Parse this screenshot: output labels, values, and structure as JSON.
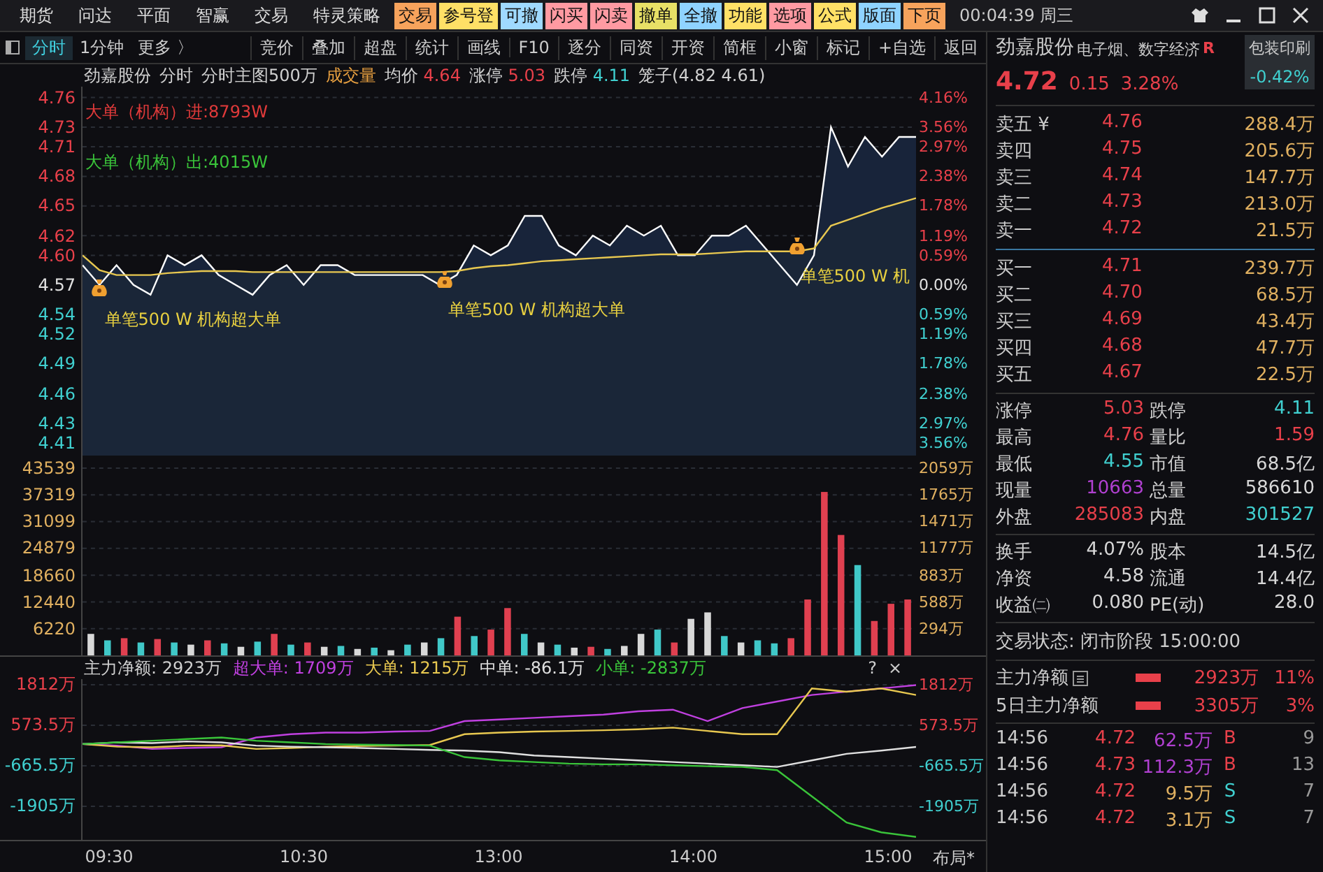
{
  "top_menu": {
    "items": [
      {
        "label": "期货"
      },
      {
        "label": "问达"
      },
      {
        "label": "平面"
      },
      {
        "label": "智赢"
      },
      {
        "label": "交易"
      },
      {
        "label": "特灵策略"
      }
    ],
    "buttons": [
      {
        "label": "交易",
        "color": "#f7a35c"
      },
      {
        "label": "参号登",
        "color": "#ffe066"
      },
      {
        "label": "可撤",
        "color": "#9fd9ff"
      },
      {
        "label": "闪买",
        "color": "#ff9aa2"
      },
      {
        "label": "闪卖",
        "color": "#ff9aa2"
      },
      {
        "label": "撤单",
        "color": "#e8e066"
      },
      {
        "label": "全撤",
        "color": "#8fd3ff"
      },
      {
        "label": "功能",
        "color": "#ffe066"
      },
      {
        "label": "选项",
        "color": "#ff9aa2"
      },
      {
        "label": "公式",
        "color": "#ffe066"
      },
      {
        "label": "版面",
        "color": "#8fd3ff"
      },
      {
        "label": "下页",
        "color": "#f7a35c"
      }
    ],
    "clock": "00:04:39",
    "weekday": "周三"
  },
  "toolbar": {
    "tabs": [
      {
        "label": "分时",
        "selected": true
      },
      {
        "label": "1分钟",
        "selected": false
      },
      {
        "label": "更多 〉",
        "selected": false
      }
    ],
    "items": [
      "竞价",
      "叠加",
      "超盘",
      "统计",
      "画线",
      "F10",
      "逐分",
      "同资",
      "开资",
      "简框",
      "小窗",
      "标记",
      "+自选",
      "返回"
    ]
  },
  "chart_header": {
    "name": "劲嘉股份",
    "mode": "分时",
    "main": "分时主图500万",
    "volume": "成交量",
    "avg": "4.64",
    "limit_up_label": "涨停",
    "limit_up": "5.03",
    "limit_down_label": "跌停",
    "limit_down": "4.11",
    "cage": "笼子(4.82 4.61)"
  },
  "price_chart": {
    "legend": [
      {
        "text": "大单（机构）进:8793W",
        "color": "#e03a3a"
      },
      {
        "text": "大单（机构）出:4015W",
        "color": "#3ac43a"
      }
    ],
    "right_labels": [
      {
        "label": "4.16%",
        "kind": "up"
      },
      {
        "label": "3.56%",
        "kind": "up"
      },
      {
        "label": "2.97%",
        "kind": "up"
      },
      {
        "label": "2.38%",
        "kind": "up"
      },
      {
        "label": "1.78%",
        "kind": "up"
      },
      {
        "label": "1.19%",
        "kind": "up"
      },
      {
        "label": "0.59%",
        "kind": "up"
      },
      {
        "label": "0.00%",
        "kind": "flat"
      },
      {
        "label": "0.59%",
        "kind": "down"
      },
      {
        "label": "1.19%",
        "kind": "down"
      },
      {
        "label": "1.78%",
        "kind": "down"
      },
      {
        "label": "2.38%",
        "kind": "down"
      },
      {
        "label": "2.97%",
        "kind": "down"
      },
      {
        "label": "3.56%",
        "kind": "down"
      }
    ],
    "chart_data": {
      "type": "area",
      "grid": true,
      "ylim": [
        4.397,
        4.771
      ],
      "yticks": [
        {
          "value": 4.76,
          "label": "4.76"
        },
        {
          "value": 4.73,
          "label": "4.73"
        },
        {
          "value": 4.71,
          "label": "4.71"
        },
        {
          "value": 4.68,
          "label": "4.68"
        },
        {
          "value": 4.65,
          "label": "4.65"
        },
        {
          "value": 4.62,
          "label": "4.62"
        },
        {
          "value": 4.6,
          "label": "4.60"
        },
        {
          "value": 4.57,
          "label": "4.57"
        },
        {
          "value": 4.54,
          "label": "4.54"
        },
        {
          "value": 4.52,
          "label": "4.52"
        },
        {
          "value": 4.49,
          "label": "4.49"
        },
        {
          "value": 4.46,
          "label": "4.46"
        },
        {
          "value": 4.43,
          "label": "4.43"
        },
        {
          "value": 4.41,
          "label": "4.41"
        }
      ],
      "series": [
        {
          "color": "#ffffff",
          "values": [
            4.59,
            4.57,
            4.59,
            4.57,
            4.56,
            4.6,
            4.59,
            4.6,
            4.58,
            4.57,
            4.56,
            4.58,
            4.59,
            4.57,
            4.59,
            4.59,
            4.58,
            4.58,
            4.58,
            4.58,
            4.58,
            4.57,
            4.58,
            4.61,
            4.6,
            4.61,
            4.64,
            4.64,
            4.61,
            4.6,
            4.62,
            4.61,
            4.63,
            4.62,
            4.63,
            4.6,
            4.6,
            4.62,
            4.62,
            4.63,
            4.61,
            4.59,
            4.57,
            4.6,
            4.73,
            4.69,
            4.72,
            4.7,
            4.72,
            4.72
          ]
        },
        {
          "name": "均价",
          "color": "#e8c850",
          "values": [
            4.6,
            4.585,
            4.58,
            4.58,
            4.58,
            4.582,
            4.583,
            4.584,
            4.584,
            4.584,
            4.583,
            4.583,
            4.583,
            4.583,
            4.583,
            4.583,
            4.583,
            4.583,
            4.583,
            4.583,
            4.583,
            4.583,
            4.584,
            4.587,
            4.589,
            4.59,
            4.592,
            4.594,
            4.595,
            4.596,
            4.597,
            4.598,
            4.599,
            4.6,
            4.601,
            4.601,
            4.601,
            4.602,
            4.603,
            4.604,
            4.604,
            4.604,
            4.604,
            4.607,
            4.63,
            4.636,
            4.642,
            4.648,
            4.653,
            4.658
          ]
        }
      ],
      "annotations": [
        "单笔500 W 机构超大单",
        "单笔500 W 机构超大单",
        "单笔500 W 机"
      ]
    }
  },
  "volume_chart": {
    "right_labels": [
      "2059万",
      "1765万",
      "1471万",
      "1177万",
      "883万",
      "588万",
      "294万"
    ],
    "chart_data": {
      "type": "bar",
      "stacked": true,
      "grid": true,
      "ylim": [
        0,
        46460
      ],
      "yticks": [
        43539,
        37319,
        31099,
        24879,
        18660,
        12440,
        6220
      ],
      "series": [
        {
          "color": "#e04050",
          "values": [
            null,
            null,
            4000,
            null,
            3800,
            null,
            null,
            3500,
            null,
            null,
            null,
            5000,
            null,
            3000,
            null,
            null,
            null,
            null,
            null,
            null,
            null,
            null,
            9000,
            null,
            6000,
            11000,
            null,
            null,
            null,
            null,
            2000,
            null,
            null,
            null,
            null,
            3000,
            null,
            null,
            null,
            null,
            null,
            null,
            4000,
            13000,
            38000,
            28000,
            null,
            8000,
            12000,
            13000
          ]
        },
        {
          "color": "#40c8c8",
          "values": [
            null,
            3500,
            null,
            3000,
            null,
            3000,
            null,
            null,
            2800,
            null,
            3200,
            null,
            2500,
            null,
            null,
            2200,
            null,
            1800,
            null,
            2500,
            null,
            4000,
            null,
            4500,
            null,
            null,
            5000,
            null,
            2500,
            null,
            null,
            1500,
            null,
            null,
            6000,
            null,
            null,
            null,
            4500,
            null,
            3500,
            2800,
            null,
            null,
            null,
            null,
            21000,
            null,
            null,
            null
          ]
        },
        {
          "color": "#d8d8d8",
          "values": [
            5000,
            null,
            null,
            null,
            null,
            null,
            2500,
            null,
            null,
            2000,
            null,
            null,
            null,
            null,
            2000,
            null,
            1500,
            null,
            1200,
            null,
            3000,
            null,
            null,
            null,
            null,
            null,
            null,
            3000,
            null,
            1800,
            null,
            null,
            2200,
            5000,
            null,
            null,
            8500,
            10000,
            null,
            3000,
            null,
            null,
            null,
            null,
            null,
            null,
            null,
            null,
            null,
            null
          ]
        }
      ]
    }
  },
  "flow_chart": {
    "main_net": "主力净额: 2923万",
    "legend_values": [
      ": 1709万",
      ": 1215万",
      ": -86.1万",
      ": -2837万"
    ],
    "help": "?",
    "close": "×",
    "right_labels": [
      {
        "label": "1812万",
        "kind": "up"
      },
      {
        "label": "573.5万",
        "kind": "up"
      },
      {
        "label": "-665.5万",
        "kind": "down"
      },
      {
        "label": "-1905万",
        "kind": "down"
      }
    ],
    "chart_data": {
      "type": "line",
      "grid": true,
      "ylim": [
        -2930,
        1983
      ],
      "yticks": [
        {
          "value": 1812,
          "label": "1812万"
        },
        {
          "value": 573.5,
          "label": "573.5万"
        },
        {
          "value": -665.5,
          "label": "-665.5万"
        },
        {
          "value": -1905,
          "label": "-1905万"
        }
      ],
      "series": [
        {
          "name": "超大单",
          "color": "#c040e0",
          "values": [
            0,
            -50,
            -150,
            -120,
            -100,
            200,
            300,
            350,
            350,
            380,
            400,
            700,
            750,
            800,
            850,
            900,
            1000,
            1050,
            700,
            1100,
            1300,
            1500,
            1600,
            1700,
            1800
          ]
        },
        {
          "name": "大单",
          "color": "#e8c850",
          "values": [
            0,
            -80,
            -100,
            -50,
            -40,
            -150,
            -120,
            -80,
            -60,
            -50,
            -30,
            300,
            350,
            380,
            400,
            420,
            450,
            500,
            400,
            300,
            300,
            1700,
            1600,
            1700,
            1500
          ]
        },
        {
          "name": "中单",
          "color": "#e0e0e0",
          "values": [
            0,
            50,
            30,
            80,
            50,
            -50,
            -80,
            -100,
            -120,
            -150,
            -180,
            -200,
            -250,
            -350,
            -400,
            -450,
            -500,
            -550,
            -600,
            -650,
            -700,
            -500,
            -300,
            -200,
            -90
          ]
        },
        {
          "name": "小单",
          "color": "#3ac43a",
          "values": [
            0,
            50,
            100,
            150,
            200,
            100,
            50,
            0,
            -20,
            -30,
            -50,
            -400,
            -500,
            -550,
            -600,
            -620,
            -620,
            -650,
            -680,
            -700,
            -800,
            -1600,
            -2400,
            -2700,
            -2840
          ]
        }
      ]
    }
  },
  "time_axis": [
    "09:30",
    "10:30",
    "13:00",
    "14:00",
    "15:00"
  ],
  "layout_button": "布局*",
  "quote": {
    "name": "劲嘉股份",
    "concepts": "电子烟、数字经济",
    "badge": "R",
    "sector": "包装印刷",
    "sector_change": "-0.42%",
    "price": "4.72",
    "change": "0.15",
    "change_pct": "3.28%",
    "asks": [
      {
        "label": "卖五 ¥",
        "price": "4.76",
        "volume": "288.4万"
      },
      {
        "label": "卖四",
        "price": "4.75",
        "volume": "205.6万"
      },
      {
        "label": "卖三",
        "price": "4.74",
        "volume": "147.7万"
      },
      {
        "label": "卖二",
        "price": "4.73",
        "volume": "213.0万"
      },
      {
        "label": "卖一",
        "price": "4.72",
        "volume": "21.5万"
      }
    ],
    "bids": [
      {
        "label": "买一",
        "price": "4.71",
        "volume": "239.7万"
      },
      {
        "label": "买二",
        "price": "4.70",
        "volume": "68.5万"
      },
      {
        "label": "买三",
        "price": "4.69",
        "volume": "43.4万"
      },
      {
        "label": "买四",
        "price": "4.68",
        "volume": "47.7万"
      },
      {
        "label": "买五",
        "price": "4.67",
        "volume": "22.5万"
      }
    ],
    "stats": [
      {
        "label": "涨停",
        "value": "5.03",
        "kind": "up"
      },
      {
        "label": "跌停",
        "value": "4.11",
        "kind": "down"
      },
      {
        "label": "最高",
        "value": "4.76",
        "kind": "up"
      },
      {
        "label": "量比",
        "value": "1.59",
        "kind": "up"
      },
      {
        "label": "最低",
        "value": "4.55",
        "kind": "down"
      },
      {
        "label": "市值",
        "value": "68.5亿",
        "kind": "plain"
      },
      {
        "label": "现量",
        "value": "10663",
        "kind": "purple"
      },
      {
        "label": "总量",
        "value": "586610",
        "kind": "plain"
      },
      {
        "label": "外盘",
        "value": "285083",
        "kind": "up"
      },
      {
        "label": "内盘",
        "value": "301527",
        "kind": "down"
      }
    ],
    "stats2": [
      {
        "label": "换手",
        "value": "4.07%",
        "kind": "plain"
      },
      {
        "label": "股本",
        "value": "14.5亿",
        "kind": "plain"
      },
      {
        "label": "净资",
        "value": "4.58",
        "kind": "plain"
      },
      {
        "label": "流通",
        "value": "14.4亿",
        "kind": "plain"
      },
      {
        "label": "收益㈡",
        "value": "0.080",
        "kind": "plain"
      },
      {
        "label": "PE(动)",
        "value": "28.0",
        "kind": "plain"
      }
    ],
    "status": "交易状态: 闭市阶段 15:00:00",
    "flows": [
      {
        "label": "主力净额",
        "has_menu": true,
        "amount": "2923万",
        "pct": "11%"
      },
      {
        "label": "5日主力净额",
        "has_menu": false,
        "amount": "3305万",
        "pct": "3%"
      }
    ],
    "ticks": [
      {
        "time": "14:56",
        "price": "4.72",
        "volume": "62.5万",
        "big": true,
        "side": "B",
        "kind": "buy",
        "count": "9"
      },
      {
        "time": "14:56",
        "price": "4.73",
        "volume": "112.3万",
        "big": true,
        "side": "B",
        "kind": "buy",
        "count": "13"
      },
      {
        "time": "14:56",
        "price": "4.72",
        "volume": "9.5万",
        "big": false,
        "side": "S",
        "kind": "sell",
        "count": "7"
      },
      {
        "time": "14:56",
        "price": "4.72",
        "volume": "3.1万",
        "big": false,
        "side": "S",
        "kind": "sell",
        "count": "7"
      }
    ]
  }
}
